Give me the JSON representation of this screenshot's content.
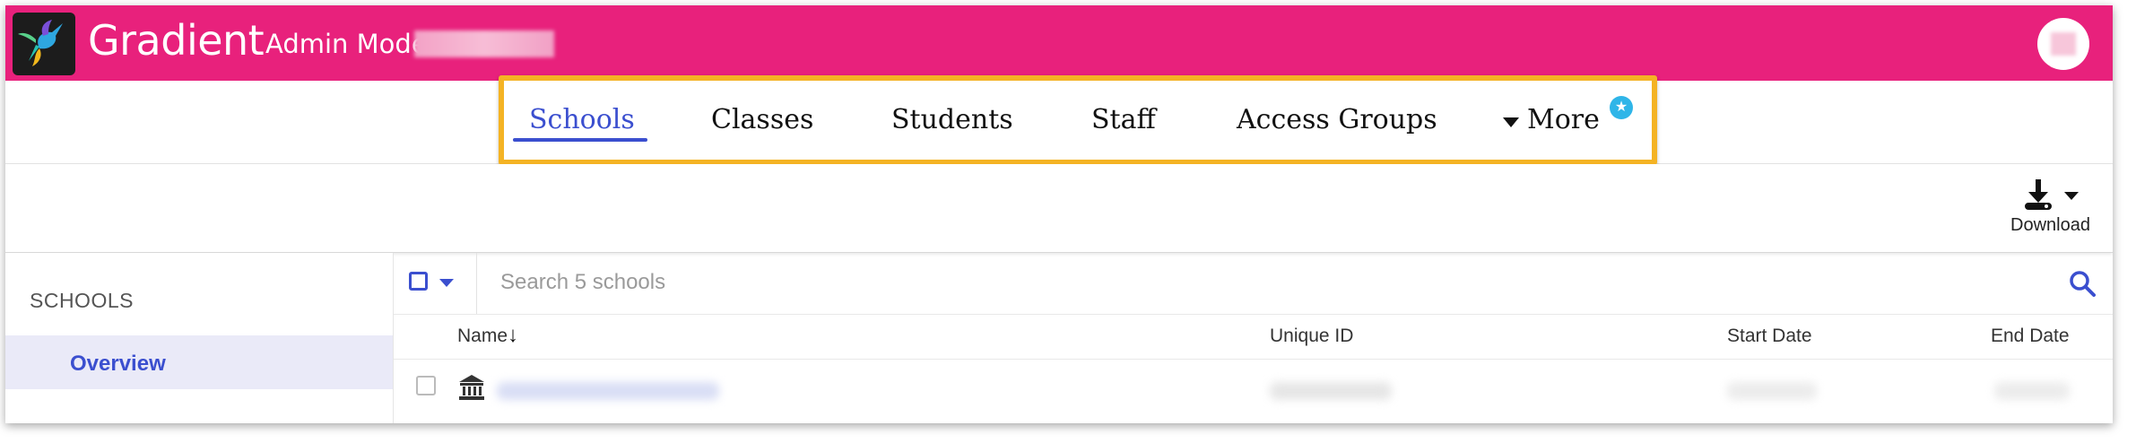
{
  "app": {
    "title": "Gradient",
    "mode_label": "Admin Mode",
    "brand_color": "#e8217c",
    "accent_color": "#3b4fcf",
    "highlight_color": "#f4b324"
  },
  "icons": {
    "logo": "hummingbird-logo",
    "avatar": "user-avatar",
    "download": "download-icon",
    "search": "search-icon",
    "school": "school-building-icon",
    "more_badge": "star-badge-icon"
  },
  "nav": {
    "tabs": [
      {
        "label": "Schools",
        "active": true
      },
      {
        "label": "Classes",
        "active": false
      },
      {
        "label": "Students",
        "active": false
      },
      {
        "label": "Staff",
        "active": false
      },
      {
        "label": "Access Groups",
        "active": false
      }
    ],
    "more_label": "More"
  },
  "toolbar": {
    "download_label": "Download"
  },
  "sidebar": {
    "heading": "SCHOOLS",
    "items": [
      {
        "label": "Overview",
        "active": true
      }
    ]
  },
  "table": {
    "search_placeholder": "Search 5 schools",
    "columns": [
      "Name",
      "Unique ID",
      "Start Date",
      "End Date"
    ],
    "sort_indicator": "↓"
  }
}
